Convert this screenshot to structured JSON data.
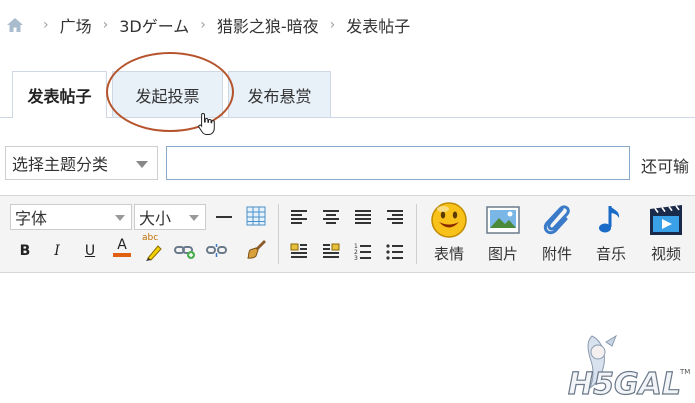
{
  "breadcrumb": {
    "items": [
      "广场",
      "3Dゲーム",
      "猎影之狼-暗夜",
      "发表帖子"
    ],
    "separator": "›"
  },
  "tabs": [
    {
      "label": "发表帖子",
      "active": true
    },
    {
      "label": "发起投票",
      "active": false
    },
    {
      "label": "发布悬赏",
      "active": false
    }
  ],
  "topic": {
    "select_value": "选择主题分类",
    "title_input_value": "",
    "remaining_text": "还可输"
  },
  "toolbar": {
    "font_select": "字体",
    "size_select": "大小",
    "format_buttons": {
      "bold": "B",
      "italic": "I",
      "underline": "U",
      "font_color": "A",
      "highlight": "abc"
    },
    "media": [
      {
        "label": "表情",
        "icon": "smiley-icon"
      },
      {
        "label": "图片",
        "icon": "image-icon"
      },
      {
        "label": "附件",
        "icon": "paperclip-icon"
      },
      {
        "label": "音乐",
        "icon": "music-note-icon"
      },
      {
        "label": "视频",
        "icon": "video-icon"
      }
    ]
  },
  "watermark": {
    "text": "H5GAL",
    "tm": "TM"
  },
  "colors": {
    "tab_bg": "#e8f0f8",
    "tab_border": "#cdd8e4",
    "highlight_ellipse": "#b5532c",
    "input_border": "#8aa8c8",
    "toolbar_bg": "#f4f4f4"
  }
}
